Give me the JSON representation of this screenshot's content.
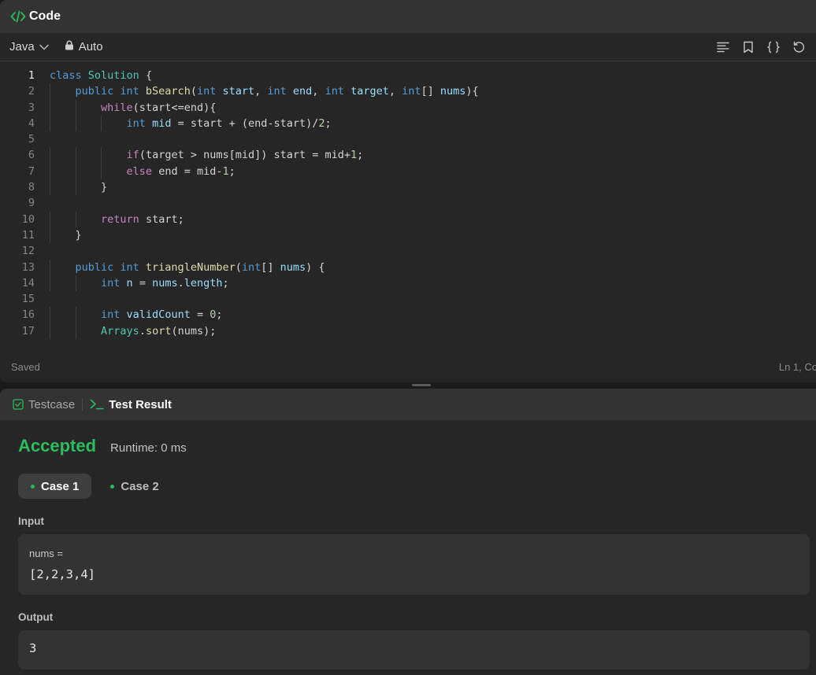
{
  "code_panel": {
    "title": "Code",
    "language": "Java",
    "mode": "Auto",
    "icons": [
      "format-icon",
      "bookmark-icon",
      "braces-icon",
      "reset-icon"
    ]
  },
  "editor": {
    "lines": [
      {
        "n": "1",
        "indent": 0,
        "tokens": [
          [
            "kw",
            "class "
          ],
          [
            "cls",
            "Solution"
          ],
          [
            "pl",
            " {"
          ]
        ]
      },
      {
        "n": "2",
        "indent": 1,
        "tokens": [
          [
            "kw",
            "public int "
          ],
          [
            "fn",
            "bSearch"
          ],
          [
            "pl",
            "("
          ],
          [
            "kw",
            "int "
          ],
          [
            "var",
            "start"
          ],
          [
            "pl",
            ", "
          ],
          [
            "kw",
            "int "
          ],
          [
            "var",
            "end"
          ],
          [
            "pl",
            ", "
          ],
          [
            "kw",
            "int "
          ],
          [
            "var",
            "target"
          ],
          [
            "pl",
            ", "
          ],
          [
            "kw",
            "int"
          ],
          [
            "pl",
            "[] "
          ],
          [
            "var",
            "nums"
          ],
          [
            "pl",
            "){"
          ]
        ]
      },
      {
        "n": "3",
        "indent": 2,
        "tokens": [
          [
            "ctl",
            "while"
          ],
          [
            "pl",
            "(start<=end){"
          ]
        ]
      },
      {
        "n": "4",
        "indent": 3,
        "tokens": [
          [
            "kw",
            "int "
          ],
          [
            "var",
            "mid"
          ],
          [
            "pl",
            " = start + (end-start)/"
          ],
          [
            "num",
            "2"
          ],
          [
            "pl",
            ";"
          ]
        ]
      },
      {
        "n": "5",
        "indent": 0,
        "tokens": []
      },
      {
        "n": "6",
        "indent": 3,
        "tokens": [
          [
            "ctl",
            "if"
          ],
          [
            "pl",
            "(target > nums[mid]) start = mid+"
          ],
          [
            "num",
            "1"
          ],
          [
            "pl",
            ";"
          ]
        ]
      },
      {
        "n": "7",
        "indent": 3,
        "tokens": [
          [
            "ctl",
            "else"
          ],
          [
            "pl",
            " end = mid-"
          ],
          [
            "num",
            "1"
          ],
          [
            "pl",
            ";"
          ]
        ]
      },
      {
        "n": "8",
        "indent": 2,
        "tokens": [
          [
            "pl",
            "}"
          ]
        ]
      },
      {
        "n": "9",
        "indent": 0,
        "tokens": []
      },
      {
        "n": "10",
        "indent": 2,
        "tokens": [
          [
            "ctl",
            "return"
          ],
          [
            "pl",
            " start;"
          ]
        ]
      },
      {
        "n": "11",
        "indent": 1,
        "tokens": [
          [
            "pl",
            "}"
          ]
        ]
      },
      {
        "n": "12",
        "indent": 0,
        "tokens": []
      },
      {
        "n": "13",
        "indent": 1,
        "tokens": [
          [
            "kw",
            "public int "
          ],
          [
            "fn",
            "triangleNumber"
          ],
          [
            "pl",
            "("
          ],
          [
            "kw",
            "int"
          ],
          [
            "pl",
            "[] "
          ],
          [
            "var",
            "nums"
          ],
          [
            "pl",
            ") {"
          ]
        ]
      },
      {
        "n": "14",
        "indent": 2,
        "tokens": [
          [
            "kw",
            "int "
          ],
          [
            "var",
            "n"
          ],
          [
            "pl",
            " = "
          ],
          [
            "var",
            "nums"
          ],
          [
            "pl",
            "."
          ],
          [
            "var",
            "length"
          ],
          [
            "pl",
            ";"
          ]
        ]
      },
      {
        "n": "15",
        "indent": 0,
        "tokens": []
      },
      {
        "n": "16",
        "indent": 2,
        "tokens": [
          [
            "kw",
            "int "
          ],
          [
            "var",
            "validCount"
          ],
          [
            "pl",
            " = "
          ],
          [
            "num",
            "0"
          ],
          [
            "pl",
            ";"
          ]
        ]
      },
      {
        "n": "17",
        "indent": 2,
        "tokens": [
          [
            "cls",
            "Arrays"
          ],
          [
            "pl",
            "."
          ],
          [
            "fn",
            "sort"
          ],
          [
            "pl",
            "(nums);"
          ]
        ]
      }
    ]
  },
  "status": {
    "saved": "Saved",
    "position": "Ln 1, Co"
  },
  "result_panel": {
    "tab_testcase": "Testcase",
    "tab_result": "Test Result",
    "verdict": "Accepted",
    "runtime": "Runtime: 0 ms",
    "cases": [
      "Case 1",
      "Case 2"
    ],
    "input_label": "Input",
    "input_var": "nums =",
    "input_value": "[2,2,3,4]",
    "output_label": "Output",
    "output_value": "3"
  },
  "colors": {
    "accent_green": "#2cbb5d",
    "keyword": "#569cd6",
    "control": "#c586c0",
    "class": "#4ec9b0",
    "function": "#dcdcaa",
    "variable": "#9cdcfe",
    "number": "#b5cea8"
  }
}
